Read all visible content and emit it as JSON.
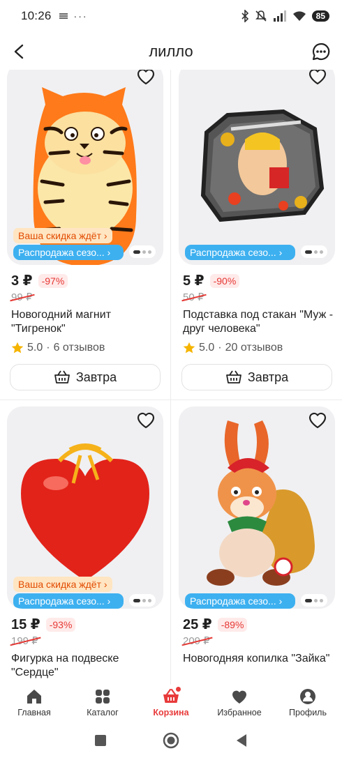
{
  "status_bar": {
    "time": "10:26",
    "battery": "85"
  },
  "header": {
    "title": "лилло"
  },
  "products": [
    {
      "price": "3 ₽",
      "discount": "-97%",
      "old_price": "99 ₽",
      "title": "Новогодний магнит \"Тигренок\"",
      "rating": "5.0",
      "reviews": "6 отзывов",
      "promo_discount": "Ваша скидка ждёт ›",
      "promo_season": "Распродажа сезо... ›",
      "deliver_label": "Завтра"
    },
    {
      "price": "5 ₽",
      "discount": "-90%",
      "old_price": "50 ₽",
      "title": "Подставка под стакан \"Муж - друг человека\"",
      "rating": "5.0",
      "reviews": "20 отзывов",
      "promo_season": "Распродажа сезо... ›",
      "deliver_label": "Завтра"
    },
    {
      "price": "15 ₽",
      "discount": "-93%",
      "old_price": "199 ₽",
      "title": "Фигурка на подвеске \"Сердце\"",
      "promo_discount": "Ваша скидка ждёт ›",
      "promo_season": "Распродажа сезо... ›"
    },
    {
      "price": "25 ₽",
      "discount": "-89%",
      "old_price": "209 ₽",
      "title": "Новогодняя копилка \"Зайка\"",
      "promo_season": "Распродажа сезо... ›"
    }
  ],
  "bottom_nav": [
    {
      "label": "Главная",
      "icon": "home-icon"
    },
    {
      "label": "Каталог",
      "icon": "catalog-icon"
    },
    {
      "label": "Корзина",
      "icon": "cart-icon",
      "active": true
    },
    {
      "label": "Избранное",
      "icon": "heart-icon"
    },
    {
      "label": "Профиль",
      "icon": "profile-icon"
    }
  ],
  "colors": {
    "accent": "#e83a3a",
    "promo_blue": "#3db0f0",
    "promo_orange": "#e24b00"
  }
}
